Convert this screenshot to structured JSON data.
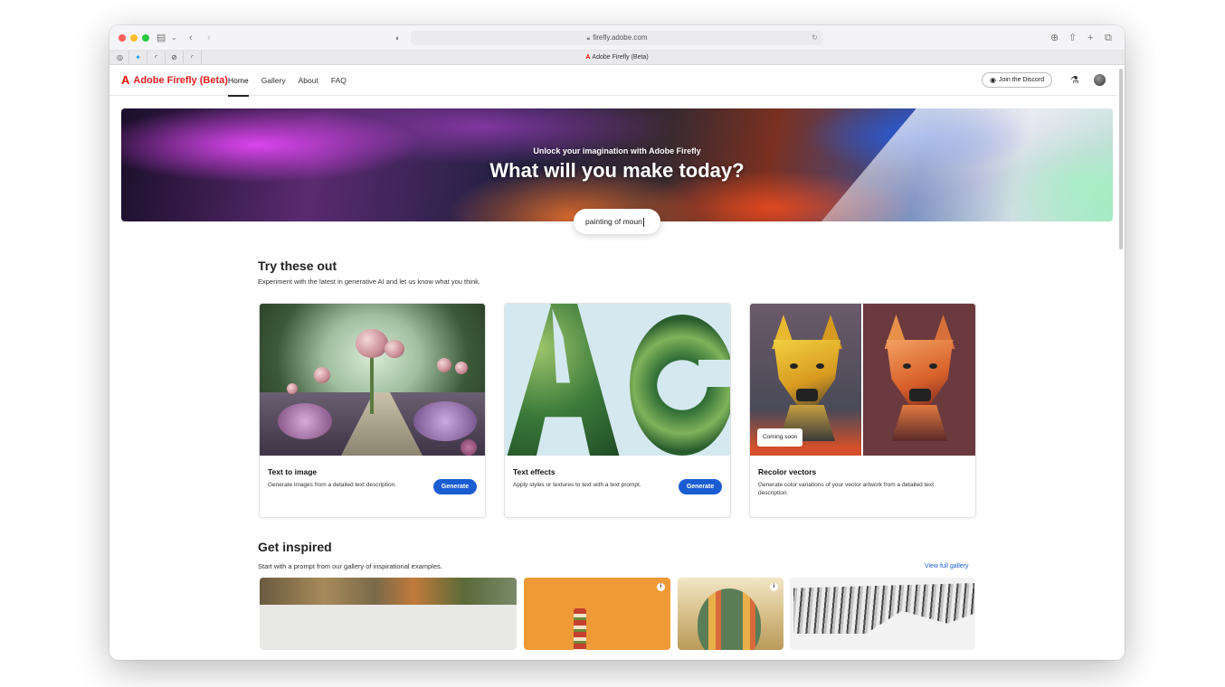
{
  "browser": {
    "url": "firefly.adobe.com",
    "tab_title": "Adobe Firefly (Beta)",
    "pinned_tabs": [
      "instagram-icon",
      "twitter-icon",
      "arc-icon",
      "compass-icon",
      "arc-icon"
    ]
  },
  "nav": {
    "brand": "Adobe Firefly (Beta)",
    "links": [
      "Home",
      "Gallery",
      "About",
      "FAQ"
    ],
    "active": "Home",
    "discord_button": "Join the Discord"
  },
  "hero": {
    "subtitle": "Unlock your imagination with Adobe Firefly",
    "title": "What will you make today?",
    "prompt_value": "painting of moun"
  },
  "try_section": {
    "title": "Try these out",
    "description": "Experiment with the latest in generative AI and let us know what you think.",
    "cards": [
      {
        "title": "Text to image",
        "description": "Generate images from a detailed text description.",
        "button": "Generate"
      },
      {
        "title": "Text effects",
        "description": "Apply styles or textures to text with a text prompt.",
        "button": "Generate"
      },
      {
        "title": "Recolor vectors",
        "description": "Generate color variations of your vector artwork from a detailed text description.",
        "badge": "Coming soon"
      }
    ]
  },
  "inspired_section": {
    "title": "Get inspired",
    "description": "Start with a prompt from our gallery of inspirational examples.",
    "link": "View full gallery"
  },
  "colors": {
    "adobe_red": "#eb1000",
    "button_blue": "#1a5cd1"
  }
}
